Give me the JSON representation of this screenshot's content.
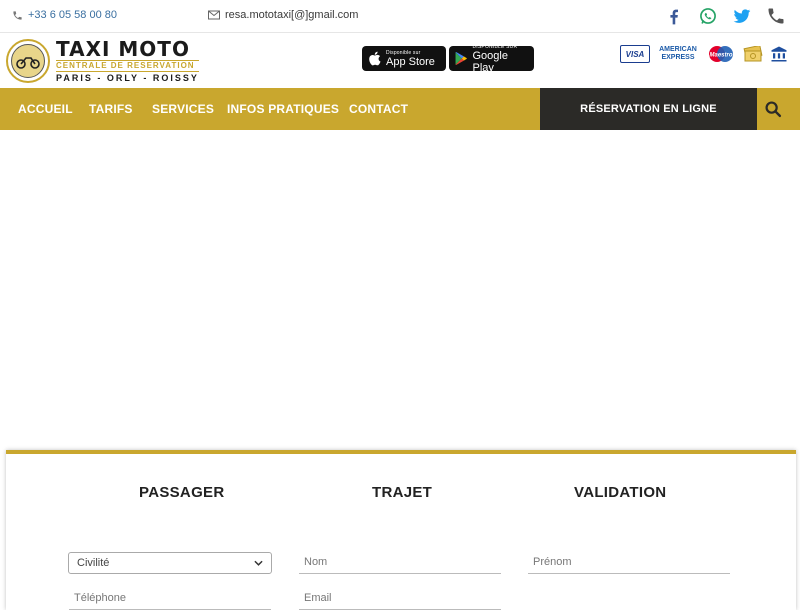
{
  "topbar": {
    "phone": "+33 6 05 58 00 80",
    "email": "resa.mototaxi[@]gmail.com",
    "social_icons": [
      "facebook-icon",
      "whatsapp-icon",
      "twitter-icon",
      "phone-icon"
    ]
  },
  "header": {
    "logo_title": "TAXI MOTO",
    "logo_subtitle": "CENTRALE DE RESERVATION",
    "logo_cities": "PARIS - ORLY - ROISSY",
    "app_store": {
      "small": "Disponible sur",
      "big": "App Store"
    },
    "google_play": {
      "small": "DISPONIBLE SUR",
      "big": "Google Play"
    },
    "payments": {
      "visa": "VISA",
      "amex_line1": "AMERICAN",
      "amex_line2": "EXPRESS",
      "maestro": "Maestro"
    }
  },
  "nav": {
    "items": [
      "ACCUEIL",
      "TARIFS",
      "SERVICES",
      "INFOS PRATIQUES",
      "CONTACT"
    ],
    "reservation": "RÉSERVATION EN LIGNE"
  },
  "form": {
    "steps": [
      "PASSAGER",
      "TRAJET",
      "VALIDATION"
    ],
    "civilite": "Civilité",
    "nom_placeholder": "Nom",
    "prenom_placeholder": "Prénom",
    "telephone_placeholder": "Téléphone",
    "email_placeholder": "Email"
  },
  "colors": {
    "accent": "#c9a72e",
    "dark": "#2b2a27",
    "facebook": "#3b5998",
    "whatsapp": "#25a366",
    "twitter": "#1da1f2"
  }
}
